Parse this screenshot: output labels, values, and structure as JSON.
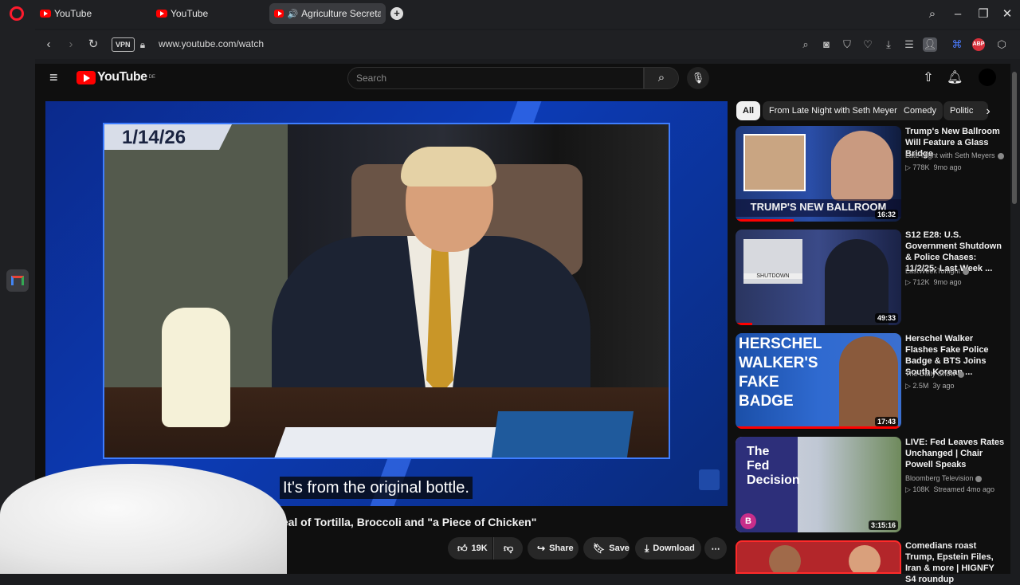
{
  "browser": {
    "tabs": [
      {
        "label": "YouTube"
      },
      {
        "label": "YouTube"
      },
      {
        "label": "Agriculture Secretary"
      }
    ],
    "vpn_label": "VPN",
    "url": "www.youtube.com/watch"
  },
  "youtube": {
    "logo_text": "YouTube",
    "region": "DE",
    "search_placeholder": "Search"
  },
  "video": {
    "date_overlay": "1/14/26",
    "caption": "It's from the original bottle.",
    "title": "\"Affordable\" Meal of Tortilla, Broccoli and \"a Piece of Chicken\"",
    "actions": {
      "likes": "19K",
      "share": "Share",
      "save": "Save",
      "download": "Download"
    }
  },
  "chips": [
    "All",
    "From Late Night with Seth Meyers",
    "Comedy",
    "Politic"
  ],
  "recommendations": [
    {
      "title": "Trump's New Ballroom Will Feature a Glass Bridge",
      "channel": "Late Night with Seth Meyers",
      "stats": "778K views · 9mo ago",
      "views": "778K",
      "age": "9mo ago",
      "duration": "16:32",
      "thumb_text": "TRUMP'S NEW BALLROOM",
      "watched_fraction": 0.35
    },
    {
      "title": "S12 E28: U.S. Government Shutdown & Police Chases: 11/2/25: Last Week ...",
      "channel": "LastWeekTonight",
      "views": "712K",
      "age": "9mo ago",
      "duration": "49:33",
      "thumb_text": "SHUTDOWN",
      "watched_fraction": 0.1
    },
    {
      "title": "Herschel Walker Flashes Fake Police Badge & BTS Joins South Korean ...",
      "channel": "The Daily Show",
      "views": "2.5M",
      "age": "3y ago",
      "duration": "17:43",
      "thumb_text": "HERSCHEL WALKER'S FAKE BADGE",
      "watched_fraction": 1.0
    },
    {
      "title": "LIVE: Fed Leaves Rates Unchanged | Chair Powell Speaks",
      "channel": "Bloomberg Television",
      "views": "108K",
      "age": "Streamed 4mo ago",
      "duration": "3:15:16",
      "thumb_text": "The Fed Decision",
      "channel_badge": "B",
      "watched_fraction": 0
    },
    {
      "title": "Comedians roast Trump, Epstein Files, Iran & more | HIGNFY S4 roundup",
      "watched_fraction": 0
    }
  ],
  "colors": {
    "youtube_red": "#ff0000",
    "page_bg": "#0f0f0f",
    "chrome_bg": "#1f2023"
  }
}
